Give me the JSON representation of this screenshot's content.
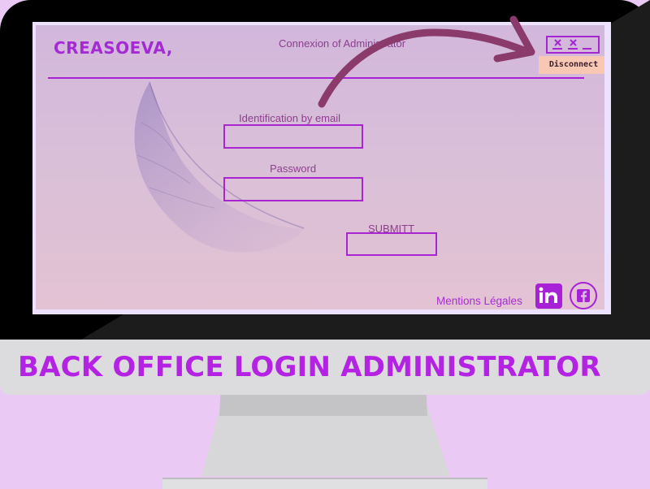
{
  "monitor": {
    "caption": "BACK OFFICE LOGIN ADMINISTRATOR"
  },
  "header": {
    "logo": "CREASOEVA,",
    "subtitle": "Connexion of Administrator",
    "close_icon": "close-window-icon",
    "disconnect_label": "Disconnect"
  },
  "form": {
    "email_label": "Identification by email",
    "email_value": "",
    "password_label": "Password",
    "password_value": "",
    "submit_label": "SUBMITT"
  },
  "footer": {
    "legal_link": "Mentions Légales",
    "linkedin_icon": "linkedin-icon",
    "facebook_icon": "facebook-icon"
  },
  "colors": {
    "accent": "#a826d1",
    "caption": "#b422e3",
    "disconnect_bg": "#f8c8b4",
    "annotation_arrow": "#8b3a6c"
  }
}
